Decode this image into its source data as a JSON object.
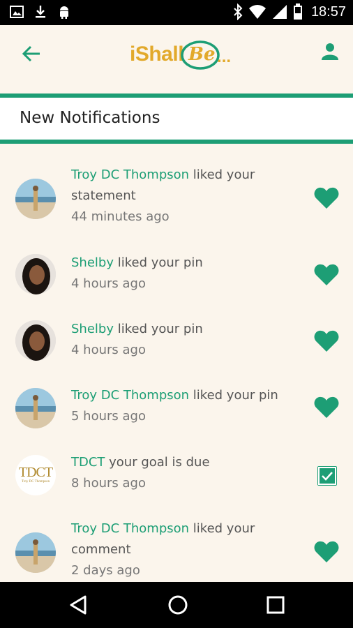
{
  "status_bar": {
    "time": "18:57",
    "icons": [
      "image-icon",
      "download-icon",
      "android-icon",
      "bluetooth-icon",
      "wifi-icon",
      "signal-icon",
      "battery-icon"
    ]
  },
  "app_bar": {
    "logo_main": "iShall",
    "logo_circle": "Be",
    "logo_dots": "...",
    "accent": "#1d9e75",
    "logo_color": "#e2a92b"
  },
  "section": {
    "title": "New Notifications"
  },
  "notifications": [
    {
      "name": "Troy DC Thompson",
      "text": " liked your statement",
      "time": "44 minutes ago",
      "avatar": "beach-photo",
      "action_icon": "heart-icon"
    },
    {
      "name": "Shelby",
      "text": " liked your pin",
      "time": "4 hours ago",
      "avatar": "portrait-photo",
      "action_icon": "heart-icon"
    },
    {
      "name": "Shelby",
      "text": " liked your pin",
      "time": "4 hours ago",
      "avatar": "portrait-photo",
      "action_icon": "heart-icon"
    },
    {
      "name": "Troy DC Thompson",
      "text": " liked your pin",
      "time": "5 hours ago",
      "avatar": "beach-photo",
      "action_icon": "heart-icon"
    },
    {
      "name": "TDCT",
      "text": " your goal is due",
      "time": "8 hours ago",
      "avatar": "tdct-logo",
      "avatar_text": "TDCT",
      "avatar_subtext": "Troy DC Thompson",
      "action_icon": "checkbox-icon"
    },
    {
      "name": "Troy DC Thompson",
      "text": " liked your comment",
      "time": "2 days ago",
      "avatar": "beach-photo",
      "action_icon": "heart-icon"
    }
  ]
}
